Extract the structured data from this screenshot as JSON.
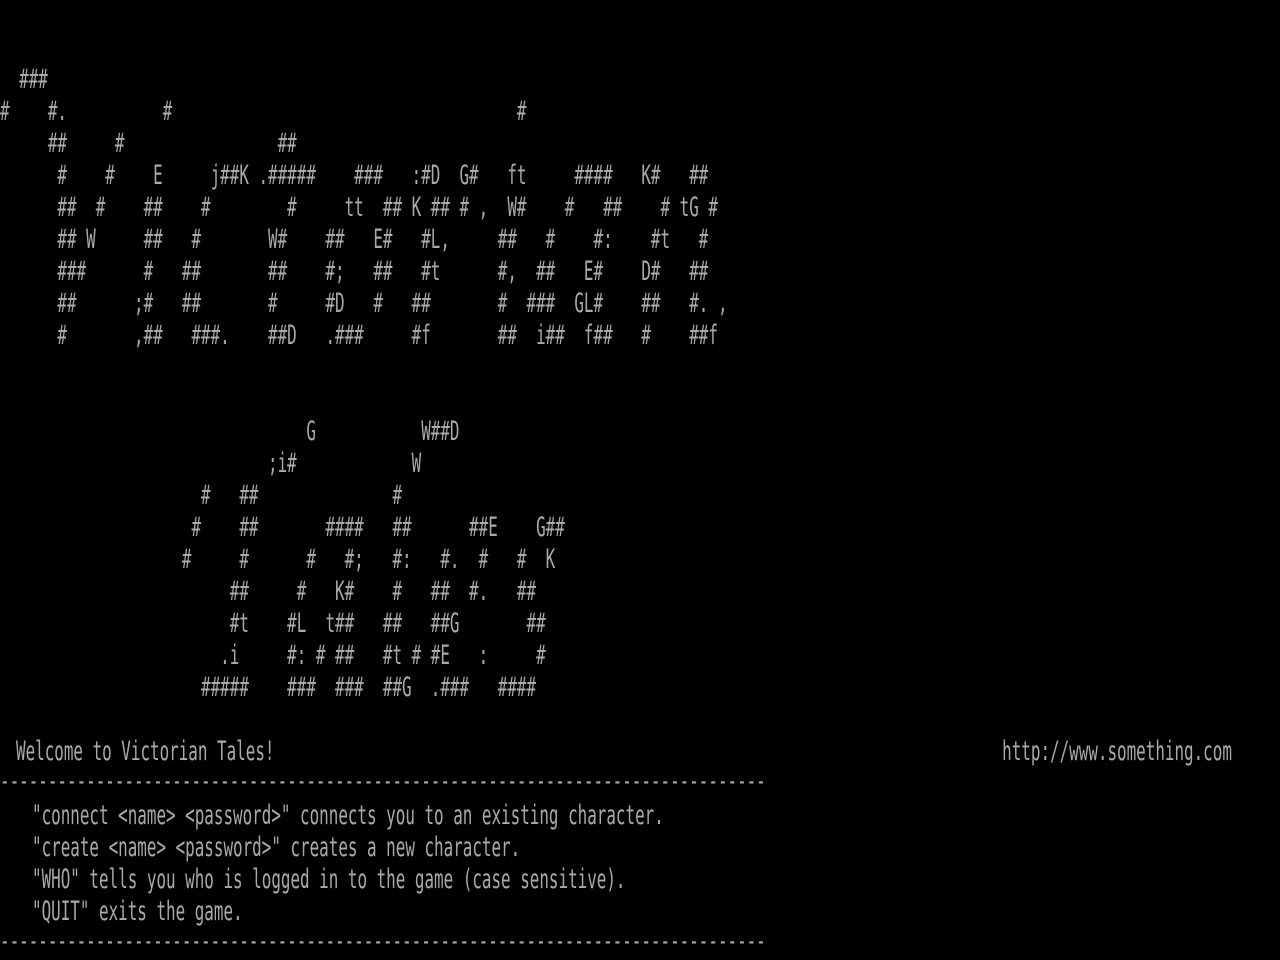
{
  "colors": {
    "background": "#000000",
    "text": "#aaaaaa"
  },
  "banner": {
    "lines": [
      "  ###",
      "#    #.          #                                    #",
      "     ##     #                ##",
      "      #    #    E     j##K .#####    ###   :#D  G#   ft     ####   K#   ##",
      "      ##  #    ##    #        #     tt  ## K ## # ,  W#    #   ##    # tG #",
      "      ## W     ##   #       W#    ##   E#   #L,     ##   #    #:    #t   #",
      "      ###      #   ##       ##    #;   ##   #t      #,  ##   E#    D#   ##",
      "      ##      ;#   ##       #     #D   #   ##       #  ###  GL#    ##   #. ,",
      "      #       ,##   ###.    ##D   .###     #f       ##  i##  f##   #    ##f"
    ],
    "subtitle_lines": [
      "                                G           W##D",
      "                            ;i#            W",
      "                     #   ##              #",
      "                    #    ##       ####   ##      ##E    G##",
      "                   #     #      #   #;   #:   #.  #   #  K",
      "                        ##     #   K#    #   ##  #.   ##",
      "                        #t    #L  t##   ##   ##G       ##",
      "                       .i     #: # ##   #t # #E   :     #",
      "                     #####    ###  ###  ##G  .###   ####"
    ]
  },
  "welcome": {
    "message": "Welcome to Victorian Tales!",
    "url": "http://www.something.com"
  },
  "divider": "--------------------------------------------------------------------------------",
  "help": {
    "lines": [
      "\"connect <name> <password>\" connects you to an existing character.",
      "\"create <name> <password>\" creates a new character.",
      "\"WHO\" tells you who is logged in to the game (case sensitive).",
      "\"QUIT\" exits the game."
    ]
  }
}
